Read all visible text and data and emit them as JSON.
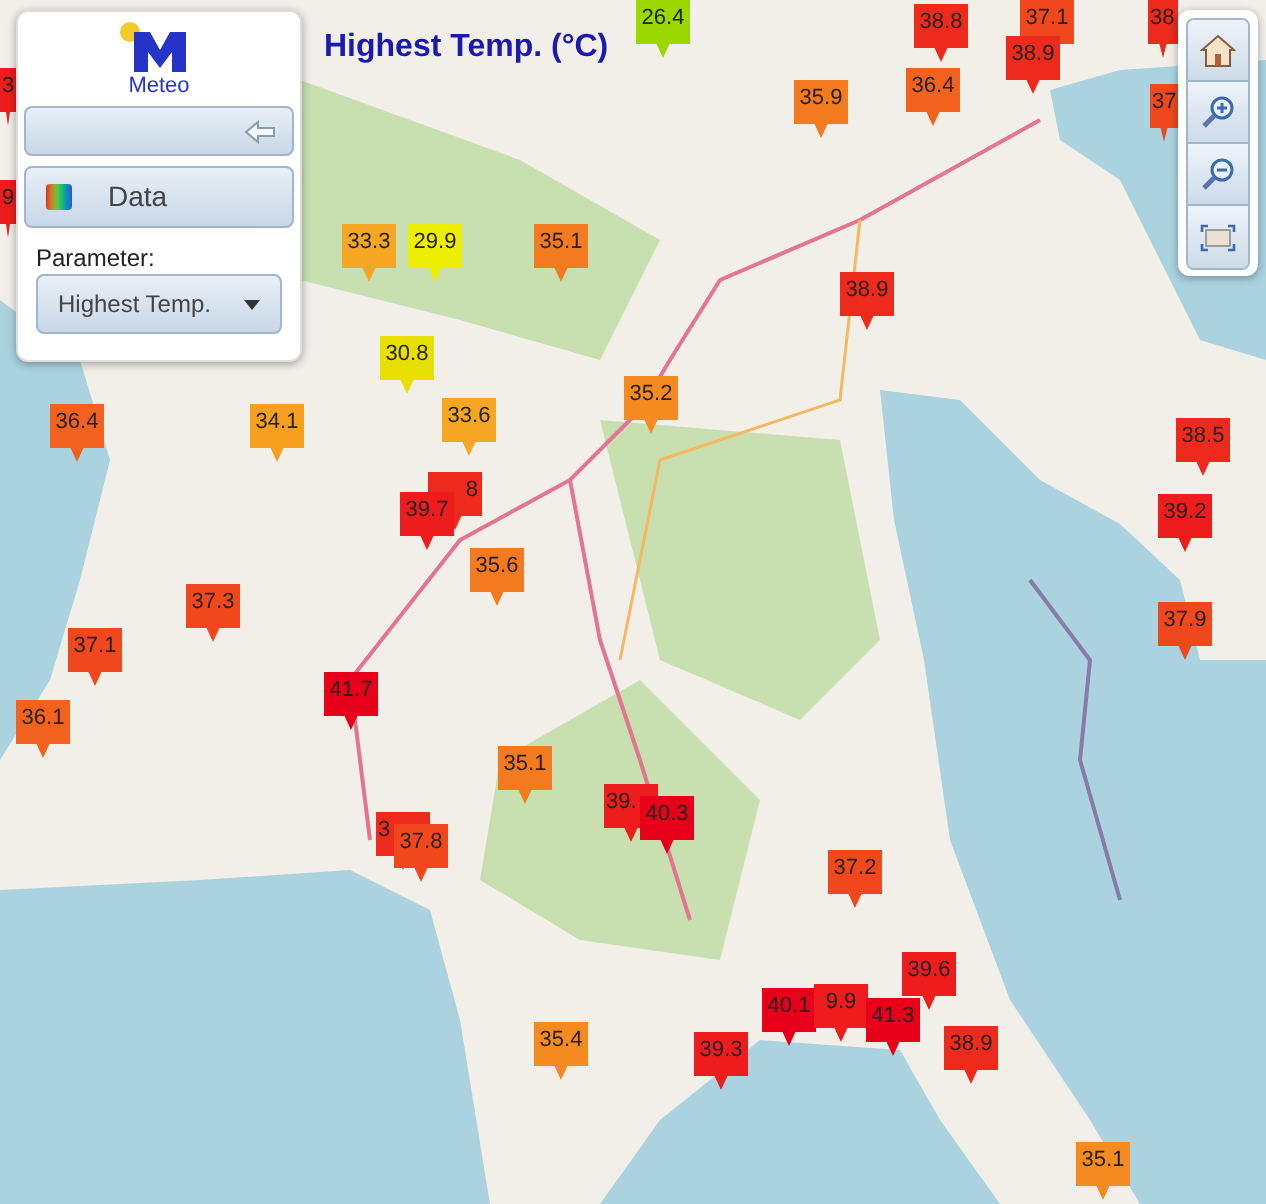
{
  "title": "Highest Temp. (°C)",
  "panel": {
    "logo_text": "Meteo",
    "data_button": "Data",
    "parameter_label": "Parameter:",
    "parameter_value": "Highest Temp."
  },
  "markers": [
    {
      "value": "3",
      "color": "#ee1c1c"
    },
    {
      "value": "9",
      "color": "#ee1c1c"
    },
    {
      "value": "26.4",
      "color": "#9ad800"
    },
    {
      "value": "38.8",
      "color": "#ee2a1c"
    },
    {
      "value": "37.1",
      "color": "#f0481c"
    },
    {
      "value": "38.9",
      "color": "#ee2a1c"
    },
    {
      "value": "38",
      "color": "#ee2a1c"
    },
    {
      "value": "37",
      "color": "#f0481c"
    },
    {
      "value": "35.9",
      "color": "#f47a20"
    },
    {
      "value": "36.4",
      "color": "#f2621e"
    },
    {
      "value": "33.3",
      "color": "#f5a623"
    },
    {
      "value": "29.9",
      "color": "#eeee00"
    },
    {
      "value": "35.1",
      "color": "#f47a20"
    },
    {
      "value": "38.9",
      "color": "#ee2a1c"
    },
    {
      "value": "30.8",
      "color": "#e8e000"
    },
    {
      "value": "35.2",
      "color": "#f48a20"
    },
    {
      "value": "36.4",
      "color": "#f2621e"
    },
    {
      "value": "34.1",
      "color": "#f7a020"
    },
    {
      "value": "33.6",
      "color": "#f5a623"
    },
    {
      "value": "8",
      "color": "#ee2a1c"
    },
    {
      "value": "39.7",
      "color": "#ee1c1c"
    },
    {
      "value": "35.6",
      "color": "#f47a20"
    },
    {
      "value": "37.3",
      "color": "#f0481c"
    },
    {
      "value": "37.1",
      "color": "#f0481c"
    },
    {
      "value": "36.1",
      "color": "#f2621e"
    },
    {
      "value": "41.7",
      "color": "#e8001a"
    },
    {
      "value": "35.1",
      "color": "#f47a20"
    },
    {
      "value": "39.",
      "color": "#ee1c1c"
    },
    {
      "value": "40.3",
      "color": "#e8001a"
    },
    {
      "value": "3",
      "color": "#ee2a1c"
    },
    {
      "value": "37.8",
      "color": "#f0481c"
    },
    {
      "value": "38.5",
      "color": "#ee2a1c"
    },
    {
      "value": "39.2",
      "color": "#ee1c1c"
    },
    {
      "value": "37.9",
      "color": "#f0481c"
    },
    {
      "value": "37.2",
      "color": "#f0481c"
    },
    {
      "value": "39.6",
      "color": "#ee1c1c"
    },
    {
      "value": "40.1",
      "color": "#e8001a"
    },
    {
      "value": "9.9",
      "color": "#ee1c1c"
    },
    {
      "value": "41.3",
      "color": "#e8001a"
    },
    {
      "value": "35.4",
      "color": "#f48a20"
    },
    {
      "value": "39.3",
      "color": "#ee1c1c"
    },
    {
      "value": "38.9",
      "color": "#ee2a1c"
    },
    {
      "value": "35.1",
      "color": "#f48a20"
    }
  ]
}
